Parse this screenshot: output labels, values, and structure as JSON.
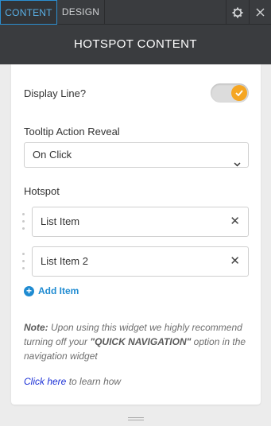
{
  "tabs": {
    "content_label": "CONTENT",
    "design_label": "DESIGN"
  },
  "header": {
    "title": "HOTSPOT CONTENT"
  },
  "display_line": {
    "label": "Display Line?",
    "enabled": true
  },
  "tooltip": {
    "label": "Tooltip Action Reveal",
    "selected": "On Click"
  },
  "hotspot": {
    "label": "Hotspot",
    "items": [
      {
        "label": "List Item"
      },
      {
        "label": "List Item 2"
      }
    ],
    "add_label": "Add Item"
  },
  "note": {
    "prefix": "Note:",
    "text1": "Upon using this widget we highly recommend turning off your",
    "emph": "\"QUICK NAVIGATION\"",
    "text2": "option in the navigation widget"
  },
  "learn": {
    "link": "Click here",
    "text": "to learn how"
  },
  "colors": {
    "accent": "#1f8bd1",
    "toggle": "#f5a623",
    "topbar": "#3a3c3f"
  }
}
